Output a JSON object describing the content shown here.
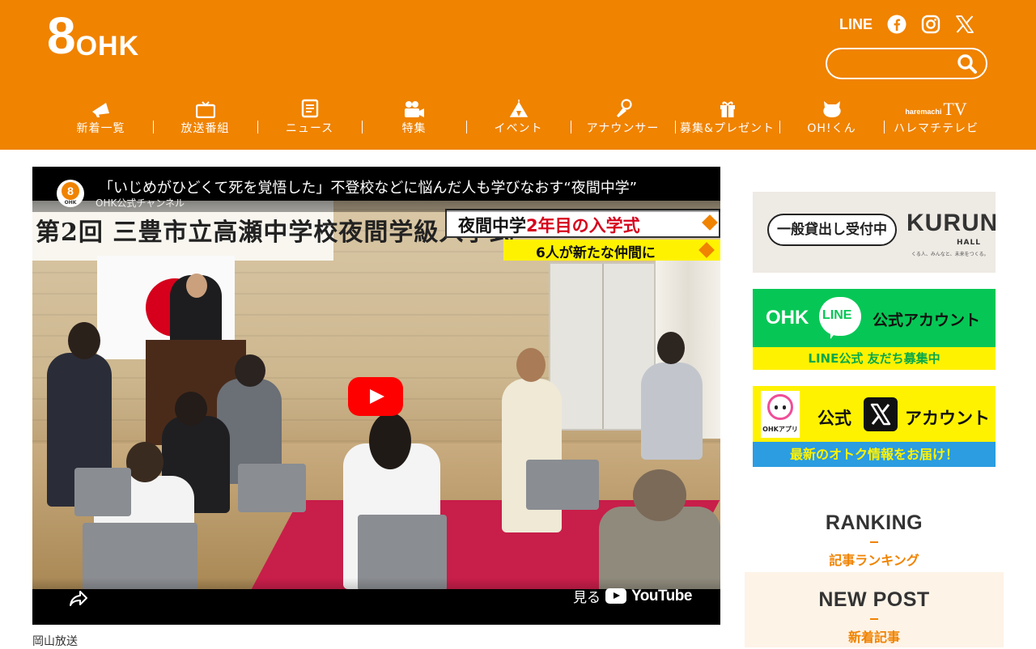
{
  "header": {
    "logo": {
      "numeral": "8",
      "text": "OHK"
    },
    "social": {
      "line_label": "LINE"
    },
    "search": {
      "placeholder": "",
      "value": ""
    },
    "nav": [
      {
        "label": "新着一覧",
        "icon": "megaphone-icon"
      },
      {
        "label": "放送番組",
        "icon": "tv-icon"
      },
      {
        "label": "ニュース",
        "icon": "news-icon"
      },
      {
        "label": "特集",
        "icon": "camera-icon"
      },
      {
        "label": "イベント",
        "icon": "tent-icon"
      },
      {
        "label": "アナウンサー",
        "icon": "microphone-icon"
      },
      {
        "label": "募集&プレゼント",
        "icon": "gift-icon"
      },
      {
        "label": "OH!くん",
        "icon": "cat-face-icon"
      },
      {
        "label": "ハレマチテレビ",
        "icon": "haremachi-tv-logo",
        "logo_small": "haremachi",
        "logo_tv": "TV"
      }
    ]
  },
  "video": {
    "title": "「いじめがひどくて死を覚悟した」不登校などに悩んだ人も学びなおす“夜間中学”",
    "channel": "OHK公式チャンネル",
    "avatar_numeral": "8",
    "avatar_text": "OHK",
    "banner_text": "第2回 三豊市立高瀬中学校夜間学級入学式",
    "ticker_main_prefix": "夜間中学",
    "ticker_main_highlight": "2年目の入学式",
    "ticker_sub": "6人が新たな仲間に",
    "watch_label": "見る",
    "youtube_label": "YouTube"
  },
  "caption": "岡山放送",
  "sidebar": {
    "kurun": {
      "tag": "一般貸出し受付中",
      "logo": "KURUN",
      "hall": "HALL",
      "sub": "くる人、みんなと、未来をつくる。"
    },
    "line": {
      "ohk": "OHK",
      "bubble": "LINE",
      "official": "公式アカウント",
      "bar": "LINE公式 友だち募集中"
    },
    "x": {
      "app": "OHKアプリ",
      "official": "公式",
      "account": "アカウント",
      "bar": "最新のオトク情報をお届け！"
    },
    "ranking": {
      "title": "RANKING",
      "sub": "記事ランキング"
    },
    "newpost": {
      "title": "NEW POST",
      "sub": "新着記事"
    }
  },
  "colors": {
    "brand": "#f08300",
    "line_green": "#06c755",
    "x_yellow": "#fff200",
    "x_blue": "#2b9de0",
    "youtube_red": "#ff0000"
  }
}
